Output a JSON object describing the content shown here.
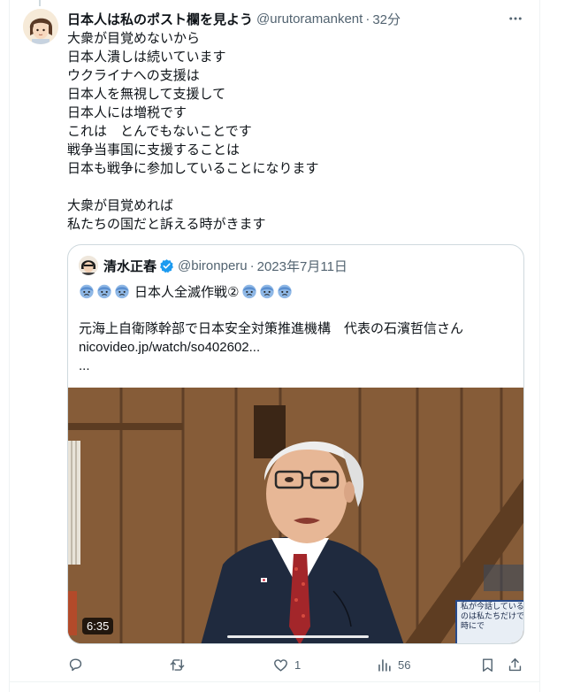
{
  "tweet": {
    "display_name": "日本人は私のポスト欄を見よう",
    "handle": "@urutoramankent",
    "separator": "·",
    "time": "32分",
    "lines": [
      "大衆が目覚めないから",
      "日本人潰しは続いています",
      "ウクライナへの支援は",
      "日本人を無視して支援して",
      "日本人には増税です",
      "これは　とんでもないことです",
      "戦争当事国に支援することは",
      "日本も戦争に参加していることになります",
      "",
      "大衆が目覚めれば",
      "私たちの国だと訴える時がきます"
    ]
  },
  "quote": {
    "display_name": "清水正春",
    "handle": "@bironperu",
    "separator": "·",
    "date": "2023年7月11日",
    "title": "日本人全滅作戦②",
    "emoji_icon": "cold-sweat-face-emoji",
    "body_lines": [
      "元海上自衛隊幹部で日本安全対策推進機構　代表の石濱哲信さん",
      "nicovideo.jp/watch/so402602...",
      "..."
    ],
    "video": {
      "duration": "6:35",
      "caption_lines": [
        "私が今話している",
        "のは私たちだけでは",
        "時にで"
      ]
    }
  },
  "actions": {
    "reply_count": "",
    "retweet_count": "",
    "like_count": "1",
    "views_count": "56"
  },
  "colors": {
    "text": "#0f1419",
    "secondary": "#536471",
    "border": "#cfd9de",
    "verified": "#1d9bf0"
  }
}
